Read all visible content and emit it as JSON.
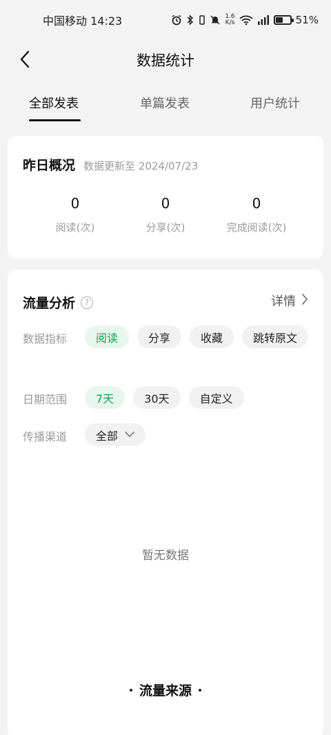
{
  "status_bar": {
    "carrier_time": "中国移动 14:23",
    "net_speed_value": "1.6",
    "net_speed_unit": "K/s",
    "battery_percent": "51%",
    "battery_level": 0.51
  },
  "header": {
    "title": "数据统计"
  },
  "tabs": [
    {
      "label": "全部发表"
    },
    {
      "label": "单篇发表"
    },
    {
      "label": "用户统计"
    }
  ],
  "overview": {
    "title": "昨日概况",
    "update_note": "数据更新至 2024/07/23",
    "stats": [
      {
        "value": "0",
        "label": "阅读(次)"
      },
      {
        "value": "0",
        "label": "分享(次)"
      },
      {
        "value": "0",
        "label": "完成阅读(次)"
      }
    ]
  },
  "traffic": {
    "title": "流量分析",
    "help_glyph": "?",
    "detail_label": "详情",
    "metrics_label": "数据指标",
    "metrics": [
      "阅读",
      "分享",
      "收藏",
      "跳转原文"
    ],
    "date_label": "日期范围",
    "date_options": [
      "7天",
      "30天",
      "自定义"
    ],
    "channel_label": "传播渠道",
    "channel_value": "全部",
    "empty_text": "暂无数据",
    "source_title": "流量来源"
  },
  "colors": {
    "accent_green": "#0aa64f",
    "chip_active_bg": "#e8f7ee",
    "page_bg": "#f2f3f2"
  }
}
